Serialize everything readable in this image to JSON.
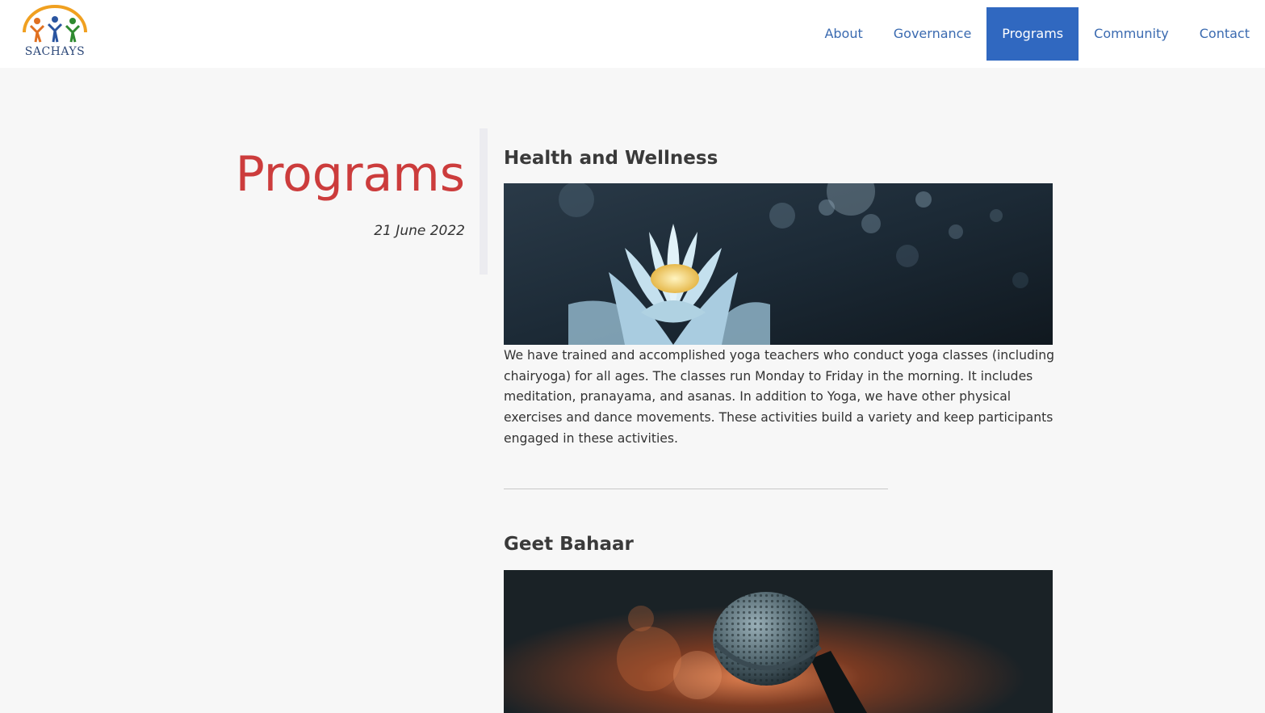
{
  "header": {
    "logo_text": "SACHAYS",
    "nav": [
      {
        "label": "About",
        "active": false
      },
      {
        "label": "Governance",
        "active": false
      },
      {
        "label": "Programs",
        "active": true
      },
      {
        "label": "Community",
        "active": false
      },
      {
        "label": "Contact",
        "active": false
      }
    ]
  },
  "page": {
    "title": "Programs",
    "date": "21 June 2022"
  },
  "sections": [
    {
      "title": "Health and Wellness",
      "image": "lotus-flower-photo",
      "text": "We have trained and accomplished yoga teachers who conduct yoga classes (including chairyoga) for all ages. The classes run Monday to Friday in the morning. It includes meditation, pranayama, and asanas. In addition to Yoga, we have other physical exercises and dance movements. These activities build a variety and keep participants engaged in these activities."
    },
    {
      "title": "Geet Bahaar",
      "image": "microphone-photo"
    }
  ],
  "colors": {
    "accent": "#3068c0",
    "title_red": "#cc3c3c",
    "nav_text": "#3a6ab0"
  }
}
